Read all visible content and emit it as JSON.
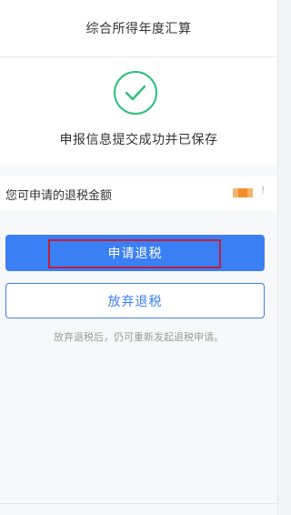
{
  "header": {
    "title": "综合所得年度汇算"
  },
  "status": {
    "icon": "check-circle-icon",
    "message": "申报信息提交成功并已保存",
    "accent_color": "#2dbf7f"
  },
  "refund": {
    "label": "您可申请的退税金额",
    "amount_state": "redacted",
    "mark": "!"
  },
  "actions": {
    "apply_label": "申请退税",
    "abandon_label": "放弃退税",
    "primary_color": "#3b7ff5",
    "highlight_color": "#c0203a"
  },
  "hint": "放弃退税后，仍可重新发起退税申请。"
}
